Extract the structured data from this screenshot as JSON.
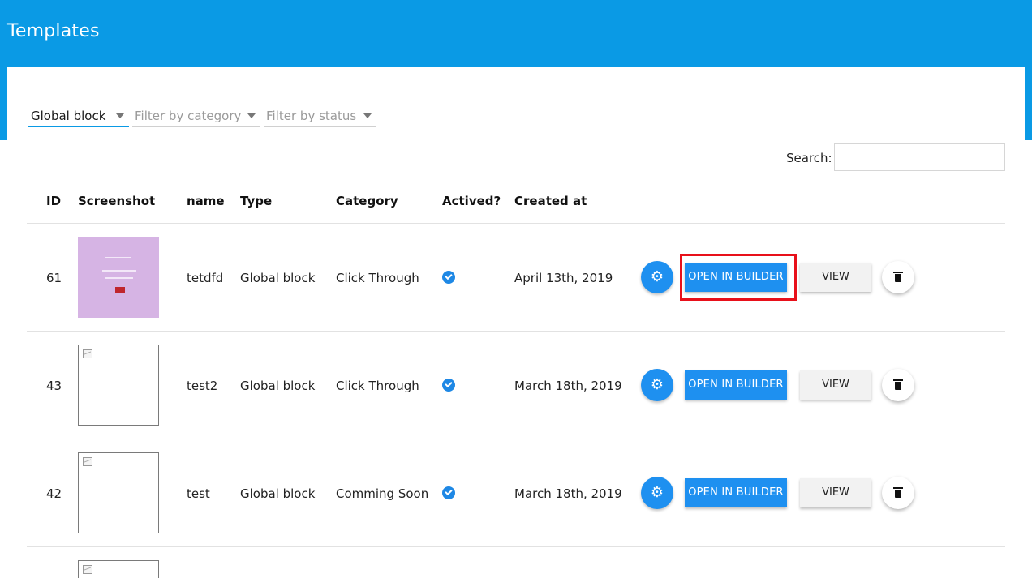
{
  "header": {
    "title": "Templates",
    "bg_color": "#0a9ae5"
  },
  "filters": {
    "type": "Global block",
    "category_placeholder": "Filter by category",
    "status_placeholder": "Filter by status"
  },
  "search": {
    "label": "Search:",
    "value": ""
  },
  "table": {
    "columns": [
      "ID",
      "Screenshot",
      "name",
      "Type",
      "Category",
      "Actived?",
      "Created at"
    ],
    "rows": [
      {
        "id": "61",
        "screenshot": "thumbnail",
        "name": "tetdfd",
        "type": "Global block",
        "category": "Click Through",
        "actived": true,
        "created_at": "April 13th, 2019"
      },
      {
        "id": "43",
        "screenshot": "broken-image",
        "name": "test2",
        "type": "Global block",
        "category": "Click Through",
        "actived": true,
        "created_at": "March 18th, 2019"
      },
      {
        "id": "42",
        "screenshot": "broken-image",
        "name": "test",
        "type": "Global block",
        "category": "Comming Soon",
        "actived": true,
        "created_at": "March 18th, 2019"
      }
    ]
  },
  "actions": {
    "open_label": "OPEN IN BUILDER",
    "view_label": "VIEW",
    "settings_icon": "gear-icon",
    "delete_icon": "trash-icon"
  },
  "colors": {
    "accent": "#1e90f0",
    "highlight": "#e8101a",
    "thumbnail": "#d6b4e4"
  }
}
